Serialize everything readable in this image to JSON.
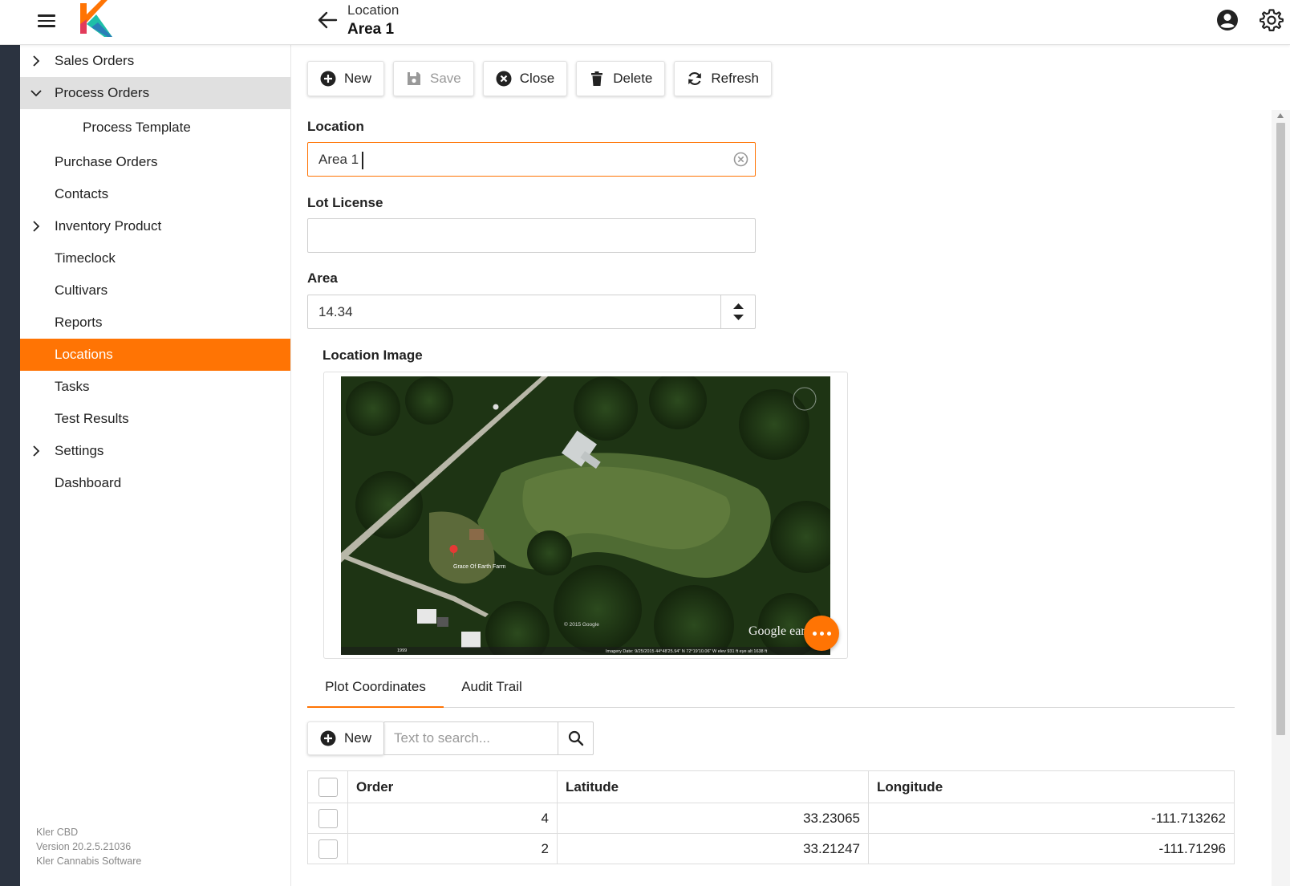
{
  "header": {
    "subtitle": "Location",
    "title": "Area 1"
  },
  "sidebar": {
    "items": [
      {
        "label": "Sales Orders",
        "chevron": "right"
      },
      {
        "label": "Process Orders",
        "chevron": "down"
      },
      {
        "label": "Process Template"
      },
      {
        "label": "Purchase Orders"
      },
      {
        "label": "Contacts"
      },
      {
        "label": "Inventory Product",
        "chevron": "right"
      },
      {
        "label": "Timeclock"
      },
      {
        "label": "Cultivars"
      },
      {
        "label": "Reports"
      },
      {
        "label": "Locations"
      },
      {
        "label": "Tasks"
      },
      {
        "label": "Test Results"
      },
      {
        "label": "Settings",
        "chevron": "right"
      },
      {
        "label": "Dashboard"
      }
    ],
    "footer": {
      "line1": "Kler CBD",
      "line2": "Version 20.2.5.21036",
      "line3": "Kler Cannabis Software"
    }
  },
  "toolbar": {
    "new_label": "New",
    "save_label": "Save",
    "close_label": "Close",
    "delete_label": "Delete",
    "refresh_label": "Refresh"
  },
  "form": {
    "location_label": "Location",
    "location_value": "Area 1",
    "lot_license_label": "Lot License",
    "lot_license_value": "",
    "area_label": "Area",
    "area_value": "14.34",
    "image_label": "Location Image"
  },
  "aerial": {
    "placemark": "Grace Of Earth Farm",
    "copyright": "© 2015 Google",
    "brand": "Google earth",
    "status": "Imagery Date: 9/25/2015   44°48'25.94\" N   72°19'10.06\" W  elev  931 ft     eye alt  1638 ft",
    "year": "1999"
  },
  "tabs": [
    {
      "label": "Plot Coordinates"
    },
    {
      "label": "Audit Trail"
    }
  ],
  "grid_toolbar": {
    "new_label": "New",
    "search_placeholder": "Text to search..."
  },
  "table": {
    "columns": [
      "Order",
      "Latitude",
      "Longitude"
    ],
    "rows": [
      {
        "order": "4",
        "latitude": "33.23065",
        "longitude": "-111.713262"
      },
      {
        "order": "2",
        "latitude": "33.21247",
        "longitude": "-111.71296"
      }
    ]
  },
  "colors": {
    "accent": "#ff7404",
    "sidebar_strip": "#2b3340"
  }
}
